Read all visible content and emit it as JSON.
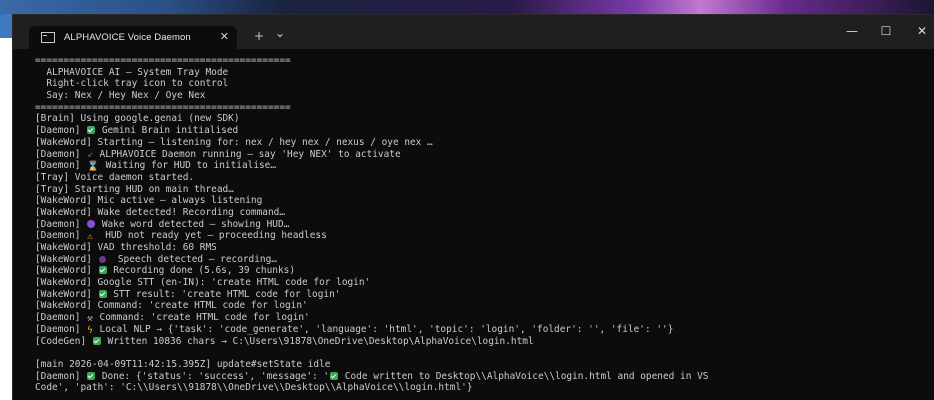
{
  "window": {
    "tab_title": "ALPHAVOICE Voice Daemon",
    "tab_close": "✕",
    "new_tab": "+",
    "dropdown": "⌄",
    "minimize": "—",
    "maximize": "☐",
    "close": "✕"
  },
  "terminal": {
    "lines": [
      {
        "text": "============================================="
      },
      {
        "text": "  ALPHAVOICE AI – System Tray Mode"
      },
      {
        "text": "  Right-click tray icon to control"
      },
      {
        "text": "  Say: Nex / Hey Nex / Oye Nex"
      },
      {
        "text": "============================================="
      },
      {
        "text": "[Brain] Using google.genai (new SDK)"
      },
      {
        "prefix": "[Daemon] ",
        "icon": "check-icon",
        "text": " Gemini Brain initialised"
      },
      {
        "text": "[WakeWord] Starting – listening for: nex / hey nex / nexus / oye nex …"
      },
      {
        "prefix": "[Daemon] ",
        "icon": "rocket-icon",
        "text": " ALPHAVOICE Daemon running – say 'Hey NEX' to activate"
      },
      {
        "prefix": "[Daemon] ",
        "icon": "hourglass-icon",
        "text": " Waiting for HUD to initialise…"
      },
      {
        "text": "[Tray] Voice daemon started."
      },
      {
        "text": "[Tray] Starting HUD on main thread…"
      },
      {
        "text": "[WakeWord] Mic active – always listening"
      },
      {
        "text": "[WakeWord] Wake detected! Recording command…"
      },
      {
        "prefix": "[Daemon] ",
        "icon": "purple-circle-icon",
        "text": " Wake word detected – showing HUD…"
      },
      {
        "prefix": "[Daemon] ",
        "icon": "warning-icon",
        "text": "  HUD not ready yet – proceeding headless"
      },
      {
        "text": "[WakeWord] VAD threshold: 60 RMS"
      },
      {
        "prefix": "[WakeWord] ",
        "icon": "speech-icon",
        "text": "  Speech detected – recording…"
      },
      {
        "prefix": "[WakeWord] ",
        "icon": "check-icon",
        "text": " Recording done (5.6s, 39 chunks)"
      },
      {
        "text": "[WakeWord] Google STT (en-IN): 'create HTML code for login'"
      },
      {
        "prefix": "[WakeWord] ",
        "icon": "check-icon",
        "text": " STT result: 'create HTML code for login'"
      },
      {
        "text": "[WakeWord] Command: 'create HTML code for login'"
      },
      {
        "prefix": "[Daemon] ",
        "icon": "hammer-icon",
        "text": " Command: 'create HTML code for login'"
      },
      {
        "prefix": "[Daemon] ",
        "icon": "bolt-icon",
        "text": " Local NLP → {'task': 'code_generate', 'language': 'html', 'topic': 'login', 'folder': '', 'file': ''}"
      },
      {
        "prefix": "[CodeGen] ",
        "icon": "check-icon",
        "text": " Written 10836 chars → C:\\Users\\91878\\OneDrive\\Desktop\\AlphaVoice\\login.html"
      },
      {
        "text": ""
      },
      {
        "text": "[main 2026-04-09T11:42:15.395Z] update#setState idle"
      },
      {
        "prefix": "[Daemon] ",
        "icon": "check-icon",
        "text": " Done: {'status': 'success', 'message': '",
        "icon2": "check-icon",
        "text2": " Code written to Desktop\\\\AlphaVoice\\\\login.html and opened in VS"
      },
      {
        "text": "Code', 'path': 'C:\\\\Users\\\\91878\\\\OneDrive\\\\Desktop\\\\AlphaVoice\\\\login.html'}"
      }
    ]
  },
  "colors": {
    "terminal_bg": "#0c0c0c",
    "terminal_text": "#cccccc",
    "titlebar_bg": "#1f1f1f"
  }
}
